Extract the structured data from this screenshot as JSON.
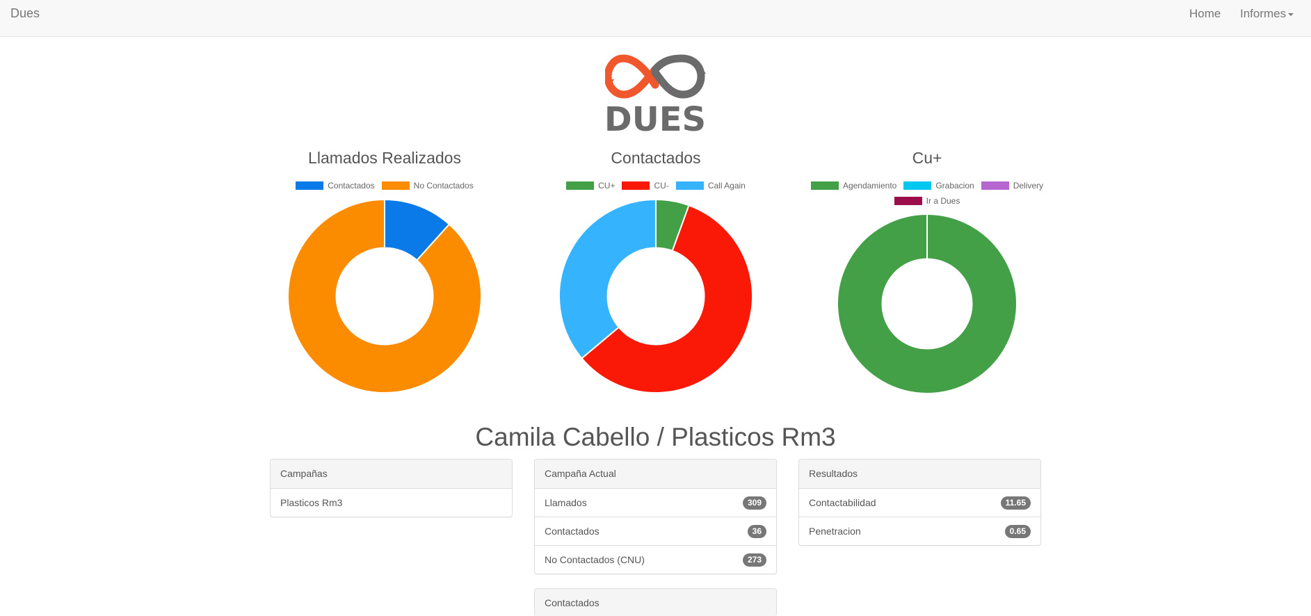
{
  "navbar": {
    "brand": "Dues",
    "home": "Home",
    "informes": "Informes"
  },
  "logo": {
    "text": "DUES",
    "colors": {
      "orange": "#f0572d",
      "gray": "#6b6b6b"
    }
  },
  "charts": [
    {
      "title": "Llamados Realizados",
      "legend": [
        {
          "label": "Contactados",
          "color": "#0a7ae8"
        },
        {
          "label": "No Contactados",
          "color": "#fb8c00"
        }
      ]
    },
    {
      "title": "Contactados",
      "legend": [
        {
          "label": "CU+",
          "color": "#43a047"
        },
        {
          "label": "CU-",
          "color": "#fa1906"
        },
        {
          "label": "Call Again",
          "color": "#35b4fd"
        }
      ]
    },
    {
      "title": "Cu+",
      "legend": [
        {
          "label": "Agendamiento",
          "color": "#43a047"
        },
        {
          "label": "Grabacion",
          "color": "#00c7f0"
        },
        {
          "label": "Delivery",
          "color": "#b666cf"
        },
        {
          "label": "Ir a Dues",
          "color": "#9c0e4b"
        }
      ]
    }
  ],
  "chart_data": [
    {
      "type": "pie",
      "title": "Llamados Realizados",
      "categories": [
        "Contactados",
        "No Contactados"
      ],
      "values": [
        36,
        273
      ],
      "colors": [
        "#0a7ae8",
        "#fb8c00"
      ]
    },
    {
      "type": "pie",
      "title": "Contactados",
      "categories": [
        "CU+",
        "CU-",
        "Call Again"
      ],
      "values": [
        2,
        21,
        13
      ],
      "colors": [
        "#43a047",
        "#fa1906",
        "#35b4fd"
      ]
    },
    {
      "type": "pie",
      "title": "Cu+",
      "categories": [
        "Agendamiento",
        "Grabacion",
        "Delivery",
        "Ir a Dues"
      ],
      "values": [
        2,
        0,
        0,
        0
      ],
      "colors": [
        "#43a047",
        "#00c7f0",
        "#b666cf",
        "#9c0e4b"
      ]
    }
  ],
  "user_title": "Camila Cabello / Plasticos Rm3",
  "panels": {
    "campanas": {
      "heading": "Campañas",
      "items": [
        "Plasticos Rm3"
      ]
    },
    "campana_actual": {
      "heading": "Campaña Actual",
      "rows": [
        {
          "label": "Llamados",
          "value": "309"
        },
        {
          "label": "Contactados",
          "value": "36"
        },
        {
          "label": "No Contactados (CNU)",
          "value": "273"
        }
      ]
    },
    "resultados": {
      "heading": "Resultados",
      "rows": [
        {
          "label": "Contactabilidad",
          "value": "11.65"
        },
        {
          "label": "Penetracion",
          "value": "0.65"
        }
      ]
    },
    "contactados": {
      "heading": "Contactados"
    }
  }
}
